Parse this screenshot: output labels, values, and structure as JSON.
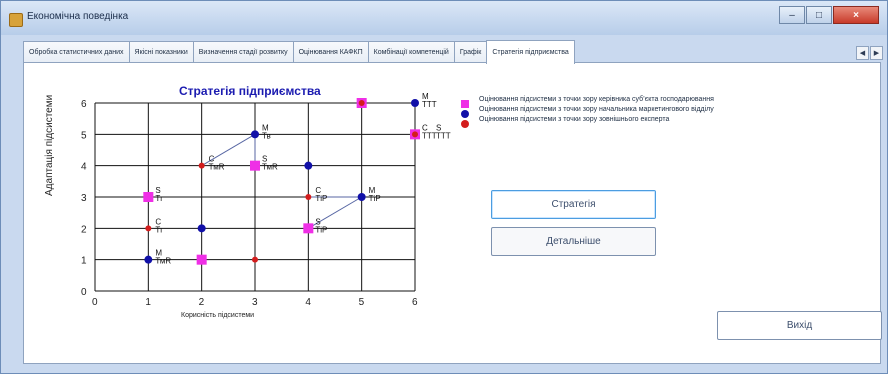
{
  "window": {
    "title": "Економічна поведінка",
    "buttons": [
      "–",
      "□",
      "×"
    ]
  },
  "tabs": [
    {
      "label": "Обробка статистичних даних",
      "active": false
    },
    {
      "label": "Якісні показники",
      "active": false
    },
    {
      "label": "Визначення стадії розвитку",
      "active": false
    },
    {
      "label": "Оцінювання КАФКП",
      "active": false
    },
    {
      "label": "Комбінації компетенцій",
      "active": false
    },
    {
      "label": "Графік",
      "active": false
    },
    {
      "label": "Стратегія підприємства",
      "active": true
    }
  ],
  "tab_nav": [
    "◀",
    "▶"
  ],
  "axis_labels": {
    "x": "Корисність підсистеми",
    "y": "Адаптація підсистеми"
  },
  "legend": [
    {
      "text": "Оцінювання підсистеми з точки зору керівника суб’єкта господарювання",
      "color": "#ef2fe6",
      "shape": "square"
    },
    {
      "text": "Оцінювання підсистеми з точки зору начальника маркетингового відділу",
      "color": "#1110a8",
      "shape": "circle"
    },
    {
      "text": "Оцінювання підсистеми з точки зору зовнішнього експерта",
      "color": "#d31d1d",
      "shape": "circle"
    }
  ],
  "buttons": {
    "strategy": "Стратегія",
    "details": "Детальніше",
    "exit": "Вихід"
  },
  "chart_data": {
    "type": "scatter",
    "title": "Стратегія підприємства",
    "xlabel": "Корисність підсистеми",
    "ylabel": "Адаптація підсистеми",
    "xlim": [
      0,
      6
    ],
    "ylim": [
      0,
      6
    ],
    "ticks": {
      "x": [
        0,
        1,
        2,
        3,
        4,
        5,
        6
      ],
      "y": [
        0,
        1,
        2,
        3,
        4,
        5,
        6
      ]
    },
    "series": [
      {
        "name": "Оцінювання підсистеми з точки зору керівника суб’єкта господарювання",
        "color": "#ef2fe6",
        "marker": "square",
        "points": [
          [
            1,
            3
          ],
          [
            2,
            1
          ],
          [
            3,
            4
          ],
          [
            4,
            2
          ],
          [
            5,
            6
          ],
          [
            6,
            5
          ]
        ]
      },
      {
        "name": "Оцінювання підсистеми з точки зору начальника маркетингового відділу",
        "color": "#1110a8",
        "marker": "circle",
        "points": [
          [
            1,
            1
          ],
          [
            2,
            2
          ],
          [
            3,
            5
          ],
          [
            4,
            4
          ],
          [
            5,
            3
          ],
          [
            6,
            6
          ]
        ]
      },
      {
        "name": "Оцінювання підсистеми з точки зору зовнішнього експерта",
        "color": "#d31d1d",
        "marker": "circle",
        "points": [
          [
            1,
            2
          ],
          [
            2,
            4
          ],
          [
            3,
            1
          ],
          [
            4,
            3
          ],
          [
            5,
            6
          ],
          [
            6,
            5
          ]
        ]
      }
    ],
    "point_labels": [
      {
        "x": 1,
        "y": 3,
        "text": "S"
      },
      {
        "x": 1,
        "y": 3,
        "text": "Тг"
      },
      {
        "x": 1,
        "y": 2,
        "text": "С"
      },
      {
        "x": 1,
        "y": 2,
        "text": "Тг"
      },
      {
        "x": 1,
        "y": 1,
        "text": "М"
      },
      {
        "x": 1,
        "y": 1,
        "text": "ТмR"
      },
      {
        "x": 2,
        "y": 4,
        "text": "С"
      },
      {
        "x": 2,
        "y": 4,
        "text": "ТмR"
      },
      {
        "x": 3,
        "y": 5,
        "text": "М"
      },
      {
        "x": 3,
        "y": 5,
        "text": "Тв"
      },
      {
        "x": 3,
        "y": 4,
        "text": "S"
      },
      {
        "x": 3,
        "y": 4,
        "text": "ТмR"
      },
      {
        "x": 4,
        "y": 3,
        "text": "С"
      },
      {
        "x": 4,
        "y": 3,
        "text": "ТіР"
      },
      {
        "x": 4,
        "y": 2,
        "text": "S"
      },
      {
        "x": 4,
        "y": 2,
        "text": "ТіР"
      },
      {
        "x": 5,
        "y": 3,
        "text": "М"
      },
      {
        "x": 5,
        "y": 3,
        "text": "ТіР"
      },
      {
        "x": 6,
        "y": 6,
        "text": "М"
      },
      {
        "x": 6,
        "y": 6,
        "text": "ТТТ"
      },
      {
        "x": 6,
        "y": 5,
        "text": "С"
      },
      {
        "x": 6,
        "y": 5,
        "text": "ТТТ"
      },
      {
        "x": 6,
        "y": 5,
        "text": "S"
      },
      {
        "x": 6,
        "y": 5,
        "text": "ТТТ"
      }
    ],
    "connectors": [
      {
        "from": [
          2,
          4
        ],
        "to": [
          3,
          5
        ]
      },
      {
        "from": [
          3,
          4
        ],
        "to": [
          3,
          5
        ]
      },
      {
        "from": [
          4,
          2
        ],
        "to": [
          5,
          3
        ]
      },
      {
        "from": [
          4,
          3
        ],
        "to": [
          5,
          3
        ]
      }
    ]
  }
}
